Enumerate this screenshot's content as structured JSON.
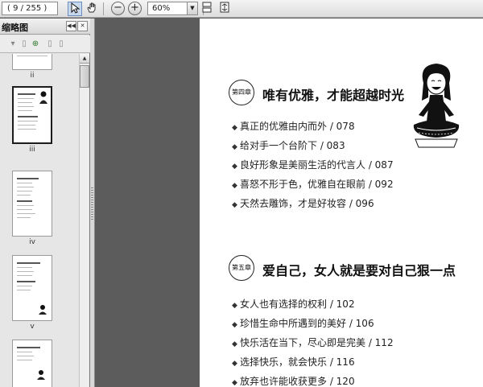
{
  "toolbar": {
    "page_indicator": "( 9 / 255 )",
    "zoom_value": "60%"
  },
  "panel": {
    "title": "缩略图",
    "thumb_labels": [
      "ii",
      "iii",
      "iv",
      "v"
    ]
  },
  "content": {
    "chapters": [
      {
        "badge": "第四章",
        "title": "唯有优雅，才能超越时光",
        "items": [
          "真正的优雅由内而外 / 078",
          "给对手一个台阶下 / 083",
          "良好形象是美丽生活的代言人 / 087",
          "喜怒不形于色，优雅自在眼前 / 092",
          "天然去雕饰，才是好妆容 / 096"
        ]
      },
      {
        "badge": "第五章",
        "title": "爱自己，女人就是要对自己狠一点",
        "items": [
          "女人也有选择的权利 / 102",
          "珍惜生命中所遇到的美好 / 106",
          "快乐活在当下，尽心即是完美 / 112",
          "选择快乐，就会快乐 / 116",
          "放弃也许能收获更多 / 120"
        ]
      }
    ]
  }
}
